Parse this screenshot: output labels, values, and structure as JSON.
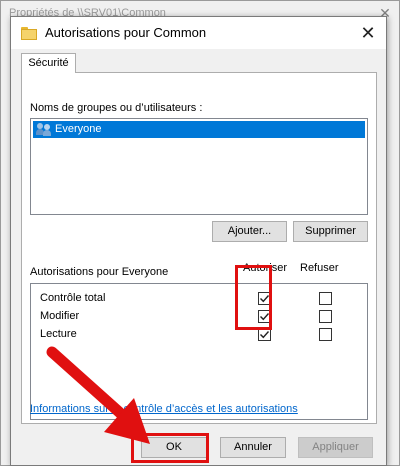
{
  "background_window": {
    "title": "Propriétés de \\\\SRV01\\Common",
    "close_glyph": "✕"
  },
  "dialog": {
    "title": "Autorisations pour Common",
    "close_glyph": "✕",
    "tab_label": "Sécurité",
    "groups_label": "Noms de groupes ou d’utilisateurs :",
    "groups": [
      {
        "name": "Everyone",
        "icon": "users-icon",
        "selected": true
      }
    ],
    "add_button": "Ajouter...",
    "remove_button": "Supprimer",
    "permissions_label": "Autorisations pour Everyone",
    "allow_column": "Autoriser",
    "deny_column": "Refuser",
    "permissions": [
      {
        "name": "Contrôle total",
        "allow": true,
        "deny": false
      },
      {
        "name": "Modifier",
        "allow": true,
        "deny": false
      },
      {
        "name": "Lecture",
        "allow": true,
        "deny": false
      }
    ],
    "info_link": "Informations sur le contrôle d’accès et les autorisations",
    "ok_button": "OK",
    "cancel_button": "Annuler",
    "apply_button": "Appliquer"
  },
  "colors": {
    "selection": "#0078d7",
    "annotation_red": "#e01010",
    "link": "#0066cc"
  }
}
